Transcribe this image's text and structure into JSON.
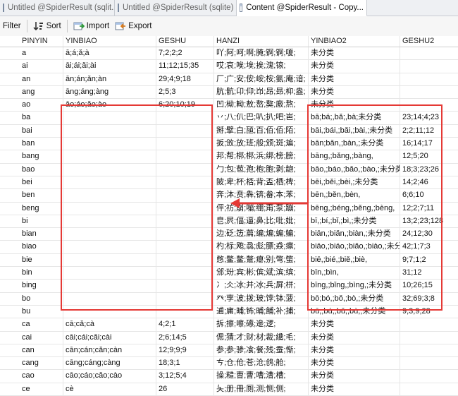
{
  "tabs": [
    {
      "label": "Untitled @SpiderResult (sqlit...",
      "active": false
    },
    {
      "label": "Untitled @SpiderResult (sqlite) ...",
      "active": false
    },
    {
      "label": "Content @SpiderResult - Copy...",
      "active": true
    }
  ],
  "toolbar": {
    "filter_label": "Filter",
    "sort_label": "Sort",
    "import_label": "Import",
    "export_label": "Export"
  },
  "columns": [
    "PINYIN",
    "YINBIAO",
    "GESHU",
    "HANZI",
    "YINBIAO2",
    "GESHU2"
  ],
  "rows": [
    {
      "marker": "",
      "pinyin": "a",
      "yinbiao": "ā;á;ǎ;à",
      "geshu": "7;2;2;2",
      "hanzi": "吖;阿;呵;啊;腌;锕;锕;嗄;",
      "yinbiao2": "未分类",
      "geshu2": ""
    },
    {
      "marker": "",
      "pinyin": "ai",
      "yinbiao": "āi;ái;ǎi;ài",
      "geshu": "11;12;15;35",
      "hanzi": "哎;哀;唉;埃;挨;溾;锿;",
      "yinbiao2": "未分类",
      "geshu2": ""
    },
    {
      "marker": "",
      "pinyin": "an",
      "yinbiao": "ān;án;ǎn;àn",
      "geshu": "29;4;9;18",
      "hanzi": "厂;广;安;侒;峖;桉;氨;庵;谙;",
      "yinbiao2": "未分类",
      "geshu2": ""
    },
    {
      "marker": "",
      "pinyin": "ang",
      "yinbiao": "āng;áng;àng",
      "geshu": "2;5;3",
      "hanzi": "肮;骯;卬;仰;岇;昂;昻;枊;盎;",
      "yinbiao2": "未分类",
      "geshu2": ""
    },
    {
      "marker": "",
      "pinyin": "ao",
      "yinbiao": "āo;áo;ǎo;ào",
      "geshu": "6;20;10;19",
      "hanzi": "凹;柪;軪;敖;嶅;獒;廒;熬;",
      "yinbiao2": "未分类",
      "geshu2": ""
    },
    {
      "marker": "",
      "pinyin": "ba",
      "yinbiao": "",
      "geshu": "",
      "hanzi": "丷;八;仈;巴;叭;扒;吧;岜;",
      "yinbiao2": "bā;bá;,bǎ;,bà;未分类",
      "geshu2": "23;14;4;23"
    },
    {
      "marker": "",
      "pinyin": "bai",
      "yinbiao": "",
      "geshu": "",
      "hanzi": "掰;擘;白;瓸;百;佰;佰;陌;",
      "yinbiao2": "bāi,;bái,;bǎi,;bài,;未分类",
      "geshu2": "2;2;11;12"
    },
    {
      "marker": "",
      "pinyin": "ban",
      "yinbiao": "",
      "geshu": "",
      "hanzi": "扳;攽;放;班;般;颁;斑;斒;",
      "yinbiao2": "bān;bǎn,;bàn,;未分类",
      "geshu2": "16;14;17"
    },
    {
      "marker": "",
      "pinyin": "bang",
      "yinbiao": "",
      "geshu": "",
      "hanzi": "邦;帮;梆;梆;浜;绑;榜;膀;",
      "yinbiao2": "bāng,;bǎng,;bàng,",
      "geshu2": "12;5;20"
    },
    {
      "marker": "",
      "pinyin": "bao",
      "yinbiao": "",
      "geshu": "",
      "hanzi": "勹;包;苞;孢;枹;胞;剥;龅;",
      "yinbiao2": "bāo,;báo,;bǎo,;bào,;未分类",
      "geshu2": "18;3;23;26"
    },
    {
      "marker": "",
      "pinyin": "bei",
      "yinbiao": "",
      "geshu": "",
      "hanzi": "陂;卑;杯;桮;背;盃;栖;椑;",
      "yinbiao2": "bēi,;běi,;bèi,;未分类",
      "geshu2": "14;2;46"
    },
    {
      "marker": "",
      "pinyin": "ben",
      "yinbiao": "",
      "geshu": "",
      "hanzi": "奔;泍;贲;犇;锛;畚;本;苯;",
      "yinbiao2": "bēn,;běn,;bèn,",
      "geshu2": "6;6;10"
    },
    {
      "marker": "",
      "pinyin": "beng",
      "yinbiao": "",
      "geshu": "",
      "hanzi": "伻;祊;崩;嘣;绷;甭;泵;蹦;",
      "yinbiao2": "bēng,;béng,;běng,;bèng,",
      "geshu2": "12;2;7;11"
    },
    {
      "marker": "",
      "pinyin": "bi",
      "yinbiao": "",
      "geshu": "",
      "hanzi": "皀;屄;偪;逼;鼻;比;吡;妣;",
      "yinbiao2": "bī,;bí,;bǐ,;bì,;未分类",
      "geshu2": "13;2;23;128"
    },
    {
      "marker": "",
      "pinyin": "bian",
      "yinbiao": "",
      "geshu": "",
      "hanzi": "边;砭;笾;萹;编;煸;蝙;鳊;",
      "yinbiao2": "biān,;biǎn,;biàn,;未分类",
      "geshu2": "24;12;30"
    },
    {
      "marker": "",
      "pinyin": "biao",
      "yinbiao": "",
      "geshu": "",
      "hanzi": "杓;标;飑;骉;彪;膘;猋;瘭;",
      "yinbiao2": "biāo,;biáo,;biǎo,;biào,;未分类",
      "geshu2": "42;1;7;3"
    },
    {
      "marker": "",
      "pinyin": "bie",
      "yinbiao": "",
      "geshu": "",
      "hanzi": "憋;鳖;鳖;蹩;瘪;别;彆;蟞;",
      "yinbiao2": "biē,;bié,;biě,;biè,",
      "geshu2": "9;7;1;2"
    },
    {
      "marker": "",
      "pinyin": "bin",
      "yinbiao": "",
      "geshu": "",
      "hanzi": "邠;玢;宾;彬;傧;斌;滨;缤;",
      "yinbiao2": "bīn,;bìn,",
      "geshu2": "31;12"
    },
    {
      "marker": "",
      "pinyin": "bing",
      "yinbiao": "",
      "geshu": "",
      "hanzi": "冫;仌;冰;并;冰;兵;屏;栟;",
      "yinbiao2": "bīng,;bǐng,;bìng,;未分类",
      "geshu2": "10;26;15"
    },
    {
      "marker": "",
      "pinyin": "bo",
      "yinbiao": "",
      "geshu": "",
      "hanzi": "癶;孛;波;拨;玻;饽;钵;菠;",
      "yinbiao2": "bō;bó,;bǒ,;bò,;未分类",
      "geshu2": "32;69;3;8"
    },
    {
      "marker": "",
      "pinyin": "bu",
      "yinbiao": "",
      "geshu": "",
      "hanzi": "逋;庯;晡;钸;晡;餔;补;捕;",
      "yinbiao2": "bū,;bú,;bǔ,;bù,;未分类",
      "geshu2": "9;3;9;28"
    },
    {
      "marker": "",
      "pinyin": "ca",
      "yinbiao": "cā;cǎ;cà",
      "geshu": "4;2;1",
      "hanzi": "拆;擦;嚓;礤;遪;逻;",
      "yinbiao2": "未分类",
      "geshu2": ""
    },
    {
      "marker": "",
      "pinyin": "cai",
      "yinbiao": "cāi;cái;cǎi;cài",
      "geshu": "2;6;14;5",
      "hanzi": "偲;猜;才;财;材;裁;纔;毛;",
      "yinbiao2": "未分类",
      "geshu2": ""
    },
    {
      "marker": "",
      "pinyin": "can",
      "yinbiao": "cān;cán;cǎn;càn",
      "geshu": "12;9;9;9",
      "hanzi": "参;参;骖;飡;餐;残;蚕;惭;",
      "yinbiao2": "未分类",
      "geshu2": ""
    },
    {
      "marker": "",
      "pinyin": "cang",
      "yinbiao": "cāng;cáng;càng",
      "geshu": "18;3;1",
      "hanzi": "ㄘ;仓;伧;苍;沧;鸧;舱;",
      "yinbiao2": "未分类",
      "geshu2": ""
    },
    {
      "marker": "",
      "pinyin": "cao",
      "yinbiao": "cāo;cáo;cǎo;cào",
      "geshu": "3;12;5;4",
      "hanzi": "操;糙;曺;曹;嘈;漕;槽;",
      "yinbiao2": "未分类",
      "geshu2": ""
    },
    {
      "marker": "",
      "pinyin": "ce",
      "yinbiao": "cè",
      "geshu": "26",
      "hanzi": "夨;册;冊;厕;测;恻;侧;",
      "yinbiao2": "未分类",
      "geshu2": ""
    }
  ]
}
